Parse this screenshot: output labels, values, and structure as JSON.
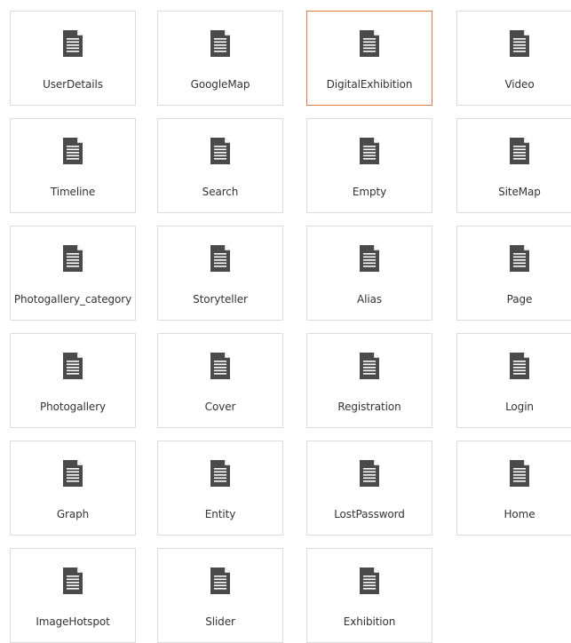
{
  "templates": [
    {
      "label": "UserDetails"
    },
    {
      "label": "GoogleMap"
    },
    {
      "label": "DigitalExhibition",
      "selected": true
    },
    {
      "label": "Video"
    },
    {
      "label": "Timeline"
    },
    {
      "label": "Search"
    },
    {
      "label": "Empty"
    },
    {
      "label": "SiteMap"
    },
    {
      "label": "Photogallery_category"
    },
    {
      "label": "Storyteller"
    },
    {
      "label": "Alias"
    },
    {
      "label": "Page"
    },
    {
      "label": "Photogallery"
    },
    {
      "label": "Cover"
    },
    {
      "label": "Registration"
    },
    {
      "label": "Login"
    },
    {
      "label": "Graph"
    },
    {
      "label": "Entity"
    },
    {
      "label": "LostPassword"
    },
    {
      "label": "Home"
    },
    {
      "label": "ImageHotspot"
    },
    {
      "label": "Slider"
    },
    {
      "label": "Exhibition"
    }
  ],
  "icon": "document-icon",
  "colors": {
    "selected_border": "#e07b45",
    "tile_border": "#dcdcdc",
    "icon_fill": "#4a4a4a",
    "label_text": "#333333"
  }
}
